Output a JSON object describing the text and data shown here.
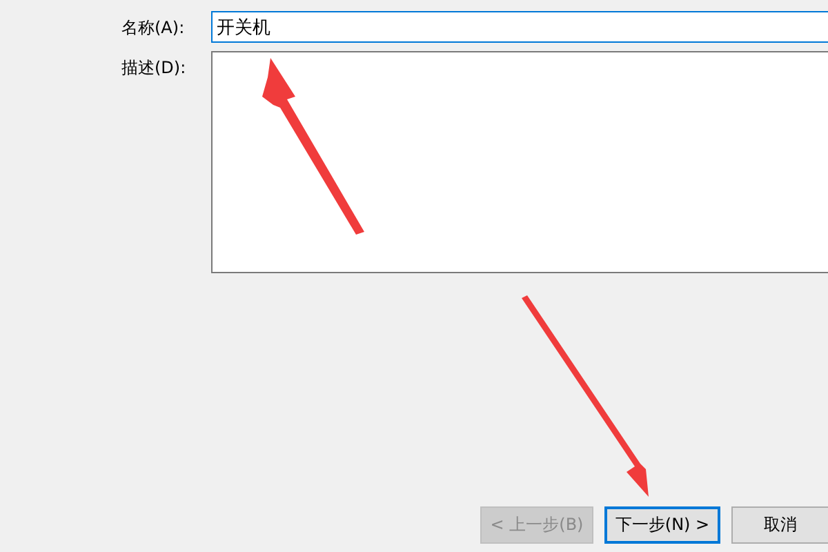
{
  "form": {
    "name_label": "名称(A):",
    "name_value": "开关机",
    "description_label": "描述(D):"
  },
  "buttons": [
    {
      "label": "< 上一步(B)",
      "disabled": true,
      "focused": false
    },
    {
      "label": "下一步(N) >",
      "disabled": false,
      "focused": true
    },
    {
      "label": "取消",
      "disabled": false,
      "focused": false
    }
  ]
}
